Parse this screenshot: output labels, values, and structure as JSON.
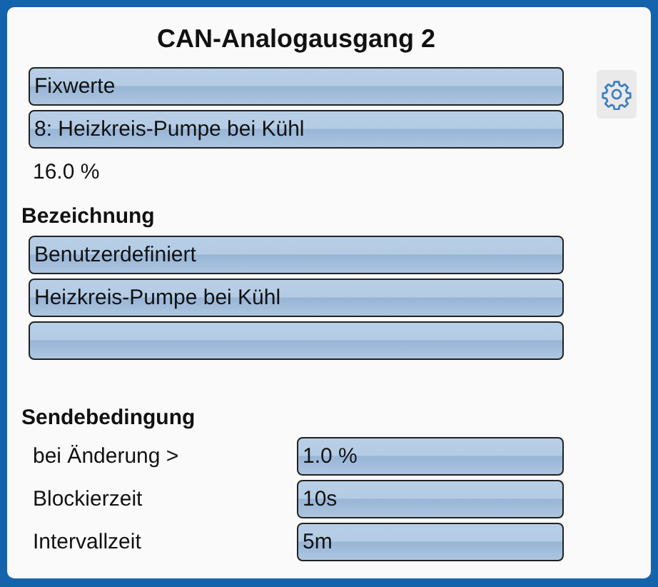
{
  "title": "CAN-Analogausgang 2",
  "source_buttons": [
    "Fixwerte",
    "8: Heizkreis-Pumpe bei Kühl"
  ],
  "value": "16.0 %",
  "designation": {
    "heading": "Bezeichnung",
    "buttons": [
      {
        "kind": "text",
        "label": "Benutzerdefiniert"
      },
      {
        "kind": "text",
        "label": "Heizkreis-Pumpe bei Kühl"
      },
      {
        "kind": "empty"
      }
    ]
  },
  "send_condition": {
    "heading": "Sendebedingung",
    "rows": [
      {
        "label": "bei Änderung >",
        "value": "1.0 %"
      },
      {
        "label": "Blockierzeit",
        "value": "10s"
      },
      {
        "label": "Intervallzeit",
        "value": "5m"
      }
    ]
  }
}
